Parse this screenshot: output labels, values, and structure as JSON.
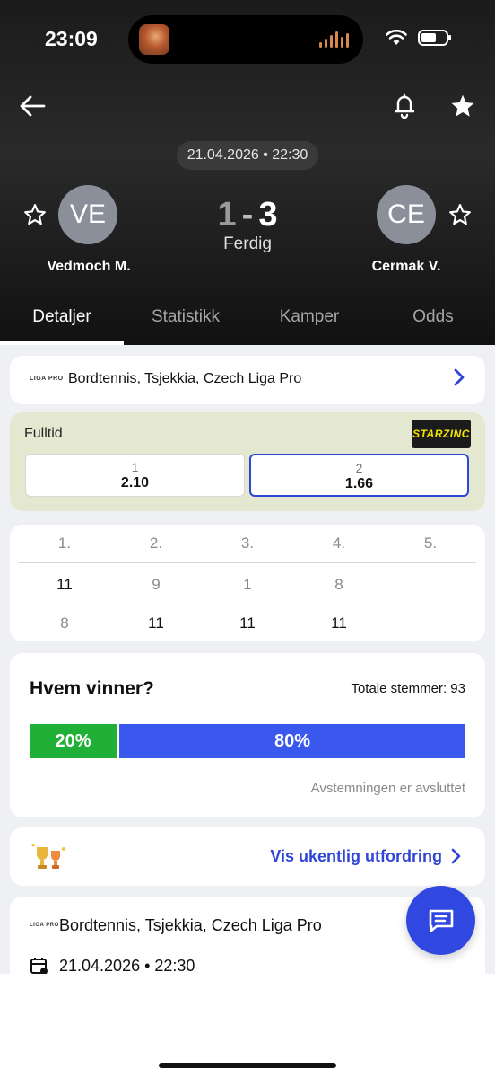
{
  "status_bar": {
    "time": "23:09",
    "battery_level": 0.6
  },
  "header": {
    "date": "21.04.2026 • 22:30",
    "home": {
      "initials": "VE",
      "name": "Vedmoch M.",
      "score": "1"
    },
    "away": {
      "initials": "CE",
      "name": "Cermak V.",
      "score": "3"
    },
    "score_separator": "-",
    "status": "Ferdig"
  },
  "tabs": [
    {
      "label": "Detaljer",
      "active": true
    },
    {
      "label": "Statistikk",
      "active": false
    },
    {
      "label": "Kamper",
      "active": false
    },
    {
      "label": "Odds",
      "active": false
    }
  ],
  "league": {
    "logo_text": "LIGA PRO",
    "name": "Bordtennis, Tsjekkia, Czech Liga Pro"
  },
  "odds": {
    "market": "Fulltid",
    "bookmaker": "STARZINC",
    "options": [
      {
        "label": "1",
        "value": "2.10",
        "selected": false
      },
      {
        "label": "2",
        "value": "1.66",
        "selected": true
      }
    ]
  },
  "sets": {
    "headers": [
      "1.",
      "2.",
      "3.",
      "4.",
      "5."
    ],
    "home": [
      "11",
      "9",
      "1",
      "8",
      ""
    ],
    "away": [
      "8",
      "11",
      "11",
      "11",
      ""
    ]
  },
  "poll": {
    "title": "Hvem vinner?",
    "total_votes": "Totale stemmer: 93",
    "home_pct": "20%",
    "away_pct": "80%",
    "home_fraction": 0.2,
    "status": "Avstemningen er avsluttet",
    "colors": {
      "home": "#20b038",
      "away": "#3a57ee"
    }
  },
  "challenge": {
    "label": "Vis ukentlig utfordring"
  },
  "info": {
    "logo_text": "LIGA PRO",
    "league": "Bordtennis, Tsjekkia, Czech Liga Pro",
    "date": "21.04.2026 • 22:30"
  },
  "colors": {
    "accent": "#2f45d6",
    "fab": "#3048e0"
  }
}
